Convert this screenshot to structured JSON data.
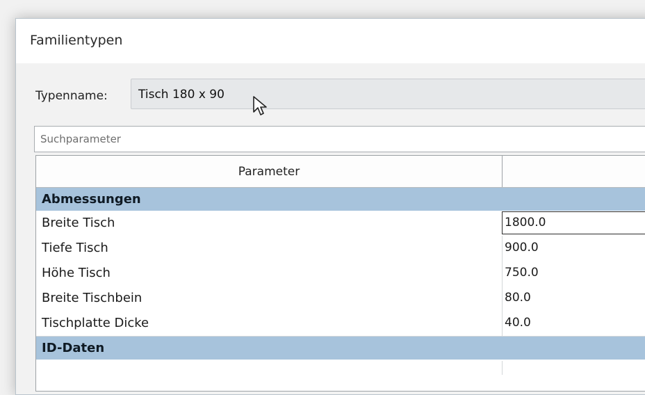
{
  "window": {
    "title": "Familientypen"
  },
  "type_name": {
    "label": "Typenname:",
    "value": "Tisch 180 x 90"
  },
  "search": {
    "placeholder": "Suchparameter",
    "value": ""
  },
  "grid": {
    "header": {
      "parameter": "Parameter",
      "value": ""
    },
    "groups": [
      {
        "label": "Abmessungen",
        "rows": [
          {
            "name": "Breite Tisch",
            "value": "1800.0",
            "selected": true
          },
          {
            "name": "Tiefe Tisch",
            "value": "900.0"
          },
          {
            "name": "Höhe Tisch",
            "value": "750.0"
          },
          {
            "name": "Breite Tischbein",
            "value": "80.0"
          },
          {
            "name": "Tischplatte Dicke",
            "value": "40.0"
          }
        ]
      },
      {
        "label": "ID-Daten",
        "rows": []
      }
    ]
  },
  "colors": {
    "group_header": "#a7c3dc",
    "dialog_bg": "#f2f2f2"
  },
  "icons": {
    "cursor": "mouse-pointer-icon"
  }
}
